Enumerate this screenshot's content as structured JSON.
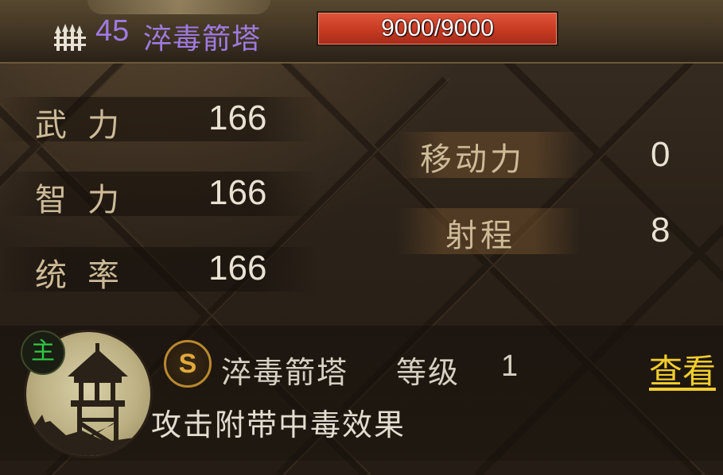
{
  "header": {
    "level": "45",
    "name": "淬毒箭塔",
    "hp": "9000/9000"
  },
  "stats": {
    "force": {
      "label": "武力",
      "value": "166"
    },
    "intelligence": {
      "label": "智力",
      "value": "166"
    },
    "command": {
      "label": "统率",
      "value": "166"
    },
    "movement": {
      "label": "移动力",
      "value": "0"
    },
    "range": {
      "label": "射程",
      "value": "8"
    }
  },
  "skill": {
    "rank_badge": "S",
    "name": "淬毒箭塔",
    "level_label": "等级",
    "level": "1",
    "description": "攻击附带中毒效果",
    "view_label": "查看"
  },
  "portrait": {
    "badge": "主"
  },
  "icons": {
    "unit_type": "arrows-icon",
    "portrait": "watchtower-icon"
  },
  "colors": {
    "name": "#9e7ae0",
    "hp_bar": "#c73a22",
    "view_link": "#f1cd2d",
    "skill_rank": "#e2a93b",
    "main_badge": "#2fc846"
  }
}
